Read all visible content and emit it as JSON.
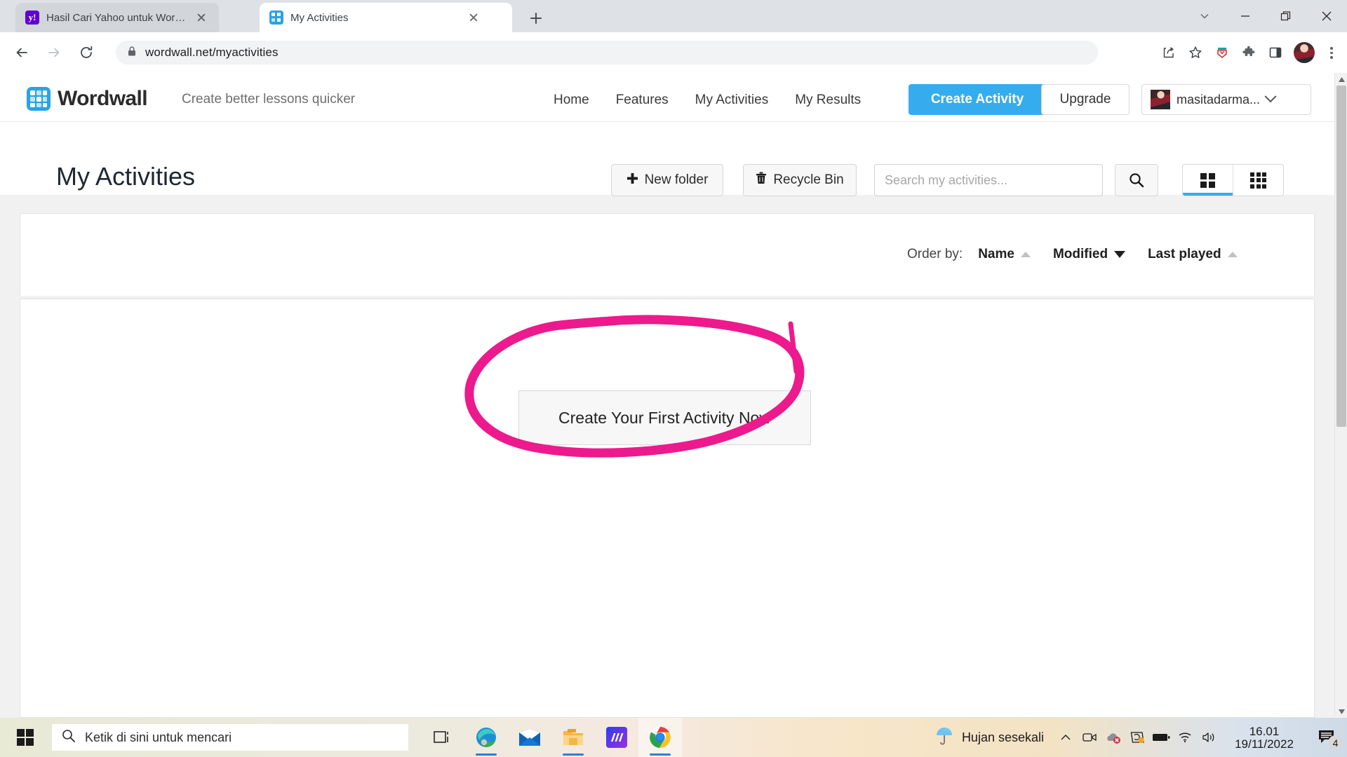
{
  "browser": {
    "tabs": [
      {
        "title": "Hasil Cari Yahoo untuk Wordwall",
        "favicon": "yahoo-icon",
        "active": false
      },
      {
        "title": "My Activities",
        "favicon": "wordwall-icon",
        "active": true
      }
    ],
    "newtab_label": "+",
    "window_controls": [
      "chevron-down-icon",
      "minimize-icon",
      "restore-icon",
      "close-icon"
    ],
    "nav": {
      "back": "back-arrow-icon",
      "forward": "forward-arrow-icon",
      "reload": "reload-icon"
    },
    "address": {
      "url": "wordwall.net/myactivities",
      "lock": "padlock-icon"
    },
    "toolbar_icons": [
      "share-icon",
      "bookmark-star-icon",
      "extension-shield-icon",
      "puzzle-extensions-icon",
      "side-panel-icon",
      "profile-avatar",
      "three-dot-menu-icon"
    ]
  },
  "site": {
    "logo_text": "Wordwall",
    "tagline": "Create better lessons quicker",
    "nav": [
      {
        "label": "Home"
      },
      {
        "label": "Features"
      },
      {
        "label": "My Activities"
      },
      {
        "label": "My Results"
      }
    ],
    "create_activity_label": "Create Activity",
    "upgrade_label": "Upgrade",
    "user_name": "masitadarma...",
    "accent_color": "#35aced"
  },
  "toolbar": {
    "page_title": "My Activities",
    "new_folder_label": "New folder",
    "recycle_bin_label": "Recycle Bin",
    "search_placeholder": "Search my activities...",
    "search_value": "",
    "view_large_grid": "grid-large-icon",
    "view_small_grid": "grid-small-icon",
    "active_view": "grid-large"
  },
  "content": {
    "order_by_label": "Order by:",
    "order_options": [
      {
        "label": "Name",
        "direction": "asc",
        "active": false
      },
      {
        "label": "Modified",
        "direction": "desc",
        "active": true
      },
      {
        "label": "Last played",
        "direction": "asc",
        "active": false
      }
    ],
    "cta_label": "Create Your First Activity Now",
    "annotation": {
      "shape": "hand-drawn-ellipse",
      "color": "#ec1a8d"
    }
  },
  "taskbar": {
    "start_label": "windows-start-icon",
    "search_placeholder": "Ketik di sini untuk mencari",
    "apps": [
      {
        "name": "task-view-icon"
      },
      {
        "name": "microsoft-edge-icon"
      },
      {
        "name": "mail-icon"
      },
      {
        "name": "file-explorer-icon"
      },
      {
        "name": "blue-m-app-icon"
      },
      {
        "name": "google-chrome-icon"
      }
    ],
    "weather_text": "Hujan sesekali",
    "weather_icon": "rain-umbrella-icon",
    "tray_icons": [
      "show-hidden-icons-chevron",
      "camera-icon",
      "onedrive-error-icon",
      "sync-warning-icon",
      "battery-icon",
      "wifi-icon",
      "volume-icon"
    ],
    "time": "16.01",
    "date": "19/11/2022",
    "notification_count": "4"
  }
}
